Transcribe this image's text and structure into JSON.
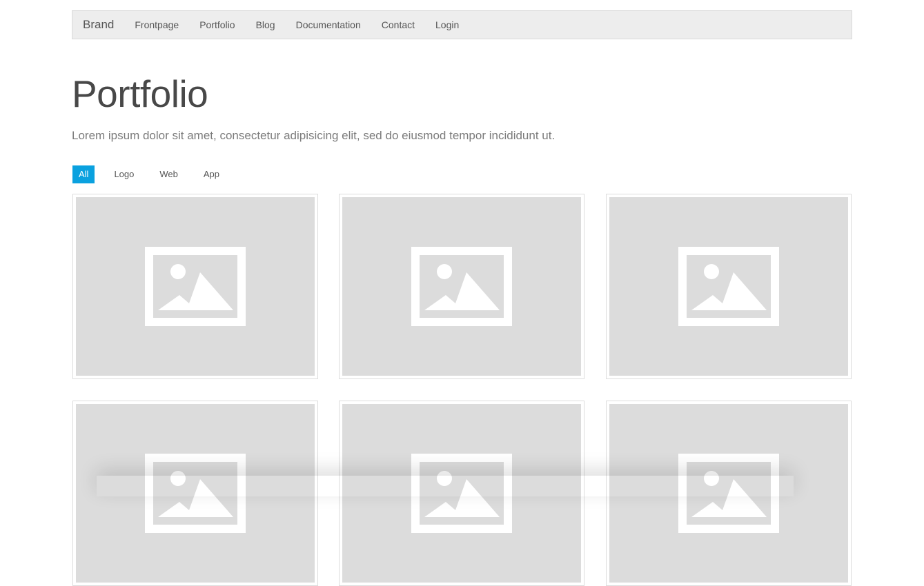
{
  "navbar": {
    "brand": "Brand",
    "links": [
      "Frontpage",
      "Portfolio",
      "Blog",
      "Documentation",
      "Contact",
      "Login"
    ]
  },
  "page": {
    "title": "Portfolio",
    "lead": "Lorem ipsum dolor sit amet, consectetur adipisicing elit, sed do eiusmod tempor incididunt ut."
  },
  "filters": {
    "items": [
      "All",
      "Logo",
      "Web",
      "App"
    ],
    "active": "All"
  },
  "colors": {
    "accent": "#0aa1df",
    "placeholder_bg": "#dcdcdc",
    "navbar_bg": "#ededed"
  },
  "portfolio": {
    "item_icon": "image-placeholder-icon",
    "item_count_visible": 6
  }
}
